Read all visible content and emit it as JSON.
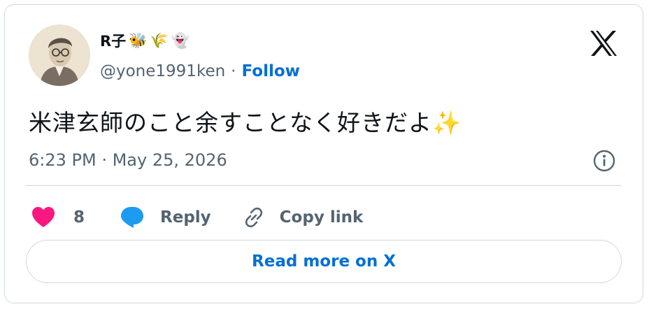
{
  "tweet": {
    "display_name": "R子",
    "name_emojis": [
      "🐝",
      "🌾",
      "👻"
    ],
    "handle": "@yone1991ken",
    "separator": "·",
    "follow_label": "Follow",
    "text": "米津玄師のこと余すことなく好きだよ",
    "text_emoji": "✨",
    "timestamp": "6:23 PM · May 25, 2026"
  },
  "actions": {
    "like_count": "8",
    "reply_label": "Reply",
    "copy_link_label": "Copy link"
  },
  "read_more_label": "Read more on X",
  "icons": {
    "logo": "x-logo-icon",
    "info": "info-icon",
    "like": "heart-icon",
    "reply": "reply-bubble-icon",
    "copy": "link-icon"
  },
  "colors": {
    "like": "#f91880",
    "reply": "#1d9bf0",
    "link": "#006fd6",
    "muted": "#536471",
    "text": "#0f1419",
    "border": "#cfd9de"
  }
}
